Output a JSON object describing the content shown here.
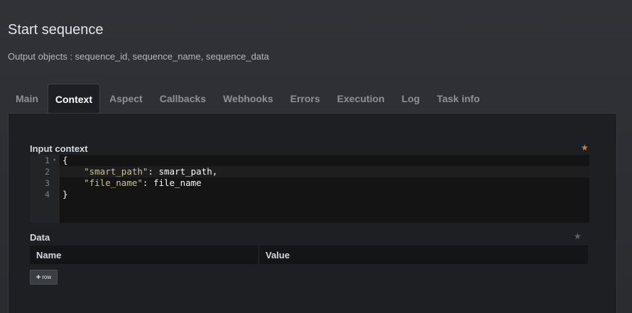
{
  "header": {
    "title": "Start sequence",
    "subtitle": "Output objects : sequence_id, sequence_name, sequence_data"
  },
  "tabs": [
    {
      "label": "Main",
      "active": false
    },
    {
      "label": "Context",
      "active": true
    },
    {
      "label": "Aspect",
      "active": false
    },
    {
      "label": "Callbacks",
      "active": false
    },
    {
      "label": "Webhooks",
      "active": false
    },
    {
      "label": "Errors",
      "active": false
    },
    {
      "label": "Execution",
      "active": false
    },
    {
      "label": "Log",
      "active": false
    },
    {
      "label": "Task info",
      "active": false
    }
  ],
  "input_context": {
    "label": "Input context",
    "star_icon": "star-icon",
    "star_color": "#c9882c",
    "lines": [
      {
        "number": "1",
        "parts": [
          {
            "text": "{",
            "type": "plain"
          }
        ]
      },
      {
        "number": "2",
        "parts": [
          {
            "text": "    ",
            "type": "plain"
          },
          {
            "text": "\"smart_path\"",
            "type": "string"
          },
          {
            "text": ": smart_path,",
            "type": "plain"
          }
        ]
      },
      {
        "number": "3",
        "parts": [
          {
            "text": "    ",
            "type": "plain"
          },
          {
            "text": "\"file_name\"",
            "type": "string"
          },
          {
            "text": ": file_name",
            "type": "plain"
          }
        ]
      },
      {
        "number": "4",
        "parts": [
          {
            "text": "}",
            "type": "plain"
          }
        ]
      }
    ]
  },
  "data_section": {
    "label": "Data",
    "star_icon": "star-icon",
    "star_color": "#5f6369",
    "columns": [
      "Name",
      "Value"
    ],
    "add_row": {
      "plus": "+",
      "label": "row"
    }
  },
  "colors": {
    "background": "#2b2d31",
    "panel": "#1d1f22",
    "editor": "#141414",
    "string": "#c7c58a"
  }
}
